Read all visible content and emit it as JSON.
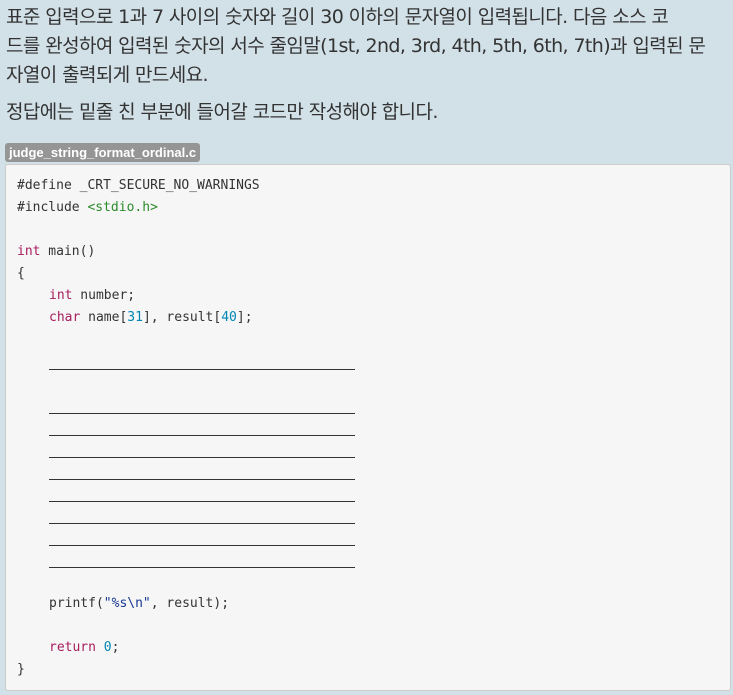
{
  "prompt": {
    "lines": [
      "표준 입력으로 1과 7 사이의 숫자와 길이 30 이하의 문자열이 입력됩니다. 다음 소스 코",
      "드를 완성하여 입력된 숫자의 서수 줄임말(1st, 2nd, 3rd, 4th, 5th, 6th, 7th)과 입력된 문",
      "자열이 출력되게 만드세요."
    ],
    "note": "정답에는 밑줄 친 부분에 들어갈 코드만 작성해야 합니다."
  },
  "file_tag": "judge_string_format_ordinal.c",
  "code": {
    "define_kw": "#define",
    "define_rest": " _CRT_SECURE_NO_WARNINGS",
    "include_kw": "#include",
    "include_header": " <stdio.h>",
    "main_type": "int",
    "main_rest": " main()",
    "open_brace": "{",
    "number_type": "int",
    "number_rest": " number;",
    "char_type": "char",
    "char_name": " name[",
    "char_n1": "31",
    "char_mid": "], result[",
    "char_n2": "40",
    "char_end": "];",
    "printf_start": "printf(",
    "printf_str": "\"%s\\n\"",
    "printf_end": ", result);",
    "return_kw": "return",
    "return_space": " ",
    "return_val": "0",
    "return_end": ";",
    "close_brace": "}"
  }
}
